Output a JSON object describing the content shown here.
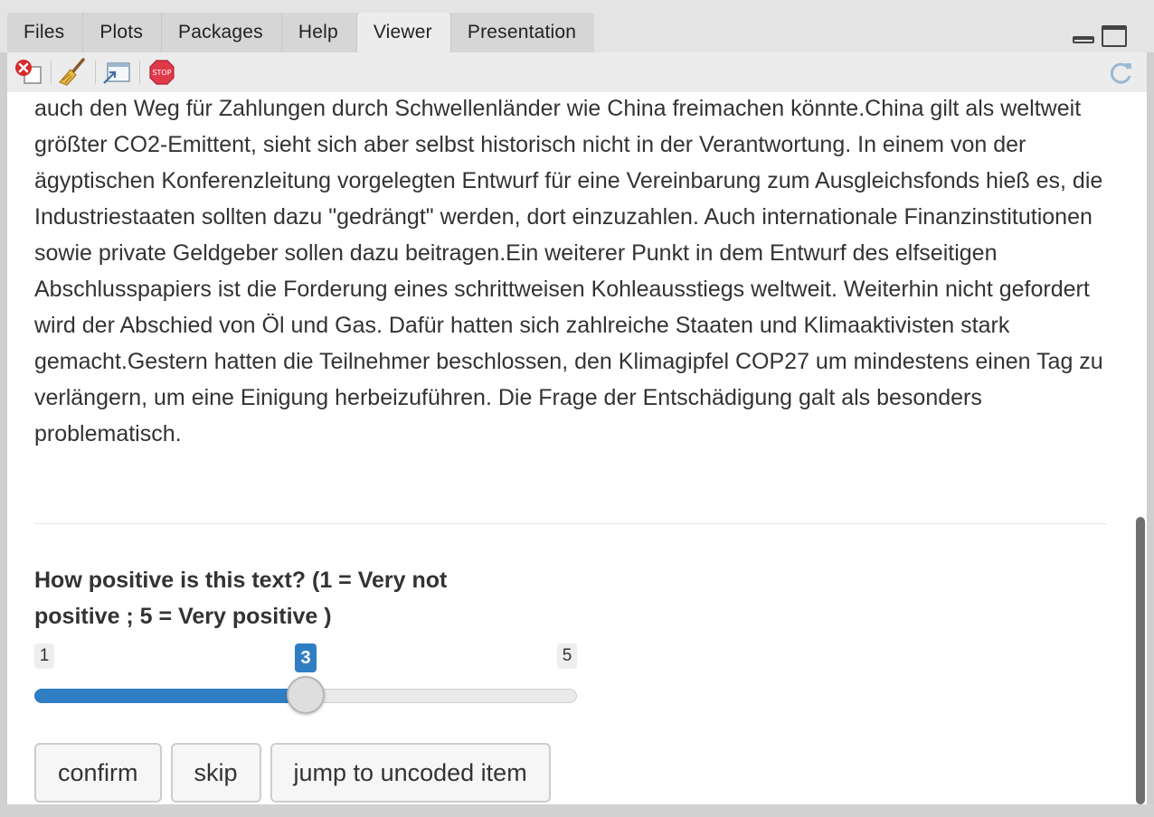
{
  "tabs": [
    {
      "label": "Files"
    },
    {
      "label": "Plots"
    },
    {
      "label": "Packages"
    },
    {
      "label": "Help"
    },
    {
      "label": "Viewer",
      "active": true
    },
    {
      "label": "Presentation"
    }
  ],
  "toolbar": {
    "icons": [
      "remove-viewer-icon",
      "clear-all-icon",
      "show-in-new-window-icon",
      "stop-icon",
      "refresh-icon"
    ],
    "stop_icon_text": "STOP"
  },
  "article": {
    "text": "auch den Weg für Zahlungen durch Schwellenländer wie China freimachen könnte.China gilt als weltweit größter CO2-Emittent, sieht sich aber selbst historisch nicht in der Verantwortung. In einem von der ägyptischen Konferenzleitung vorgelegten Entwurf für eine Vereinbarung zum Ausgleichsfonds hieß es, die Industriestaaten sollten dazu \"gedrängt\" werden, dort einzuzahlen. Auch internationale Finanzinstitutionen sowie private Geldgeber sollen dazu beitragen.Ein weiterer Punkt in dem Entwurf des elfseitigen Abschlusspapiers ist die Forderung eines schrittweisen Kohleausstiegs weltweit. Weiterhin nicht gefordert wird der Abschied von Öl und Gas. Dafür hatten sich zahlreiche Staaten und Klimaaktivisten stark gemacht.Gestern hatten die Teilnehmer beschlossen, den Klimagipfel COP27 um mindestens einen Tag zu verlängern, um eine Einigung herbeizuführen. Die Frage der Entschädigung galt als besonders problematisch."
  },
  "question": {
    "label": "How positive is this text? (1 = Very not positive ; 5 = Very positive )"
  },
  "slider": {
    "min": "1",
    "max": "5",
    "value": "3",
    "fraction": 0.5,
    "accent_color": "#2f7ec4"
  },
  "buttons": {
    "confirm": "confirm",
    "skip": "skip",
    "jump": "jump to uncoded item"
  }
}
